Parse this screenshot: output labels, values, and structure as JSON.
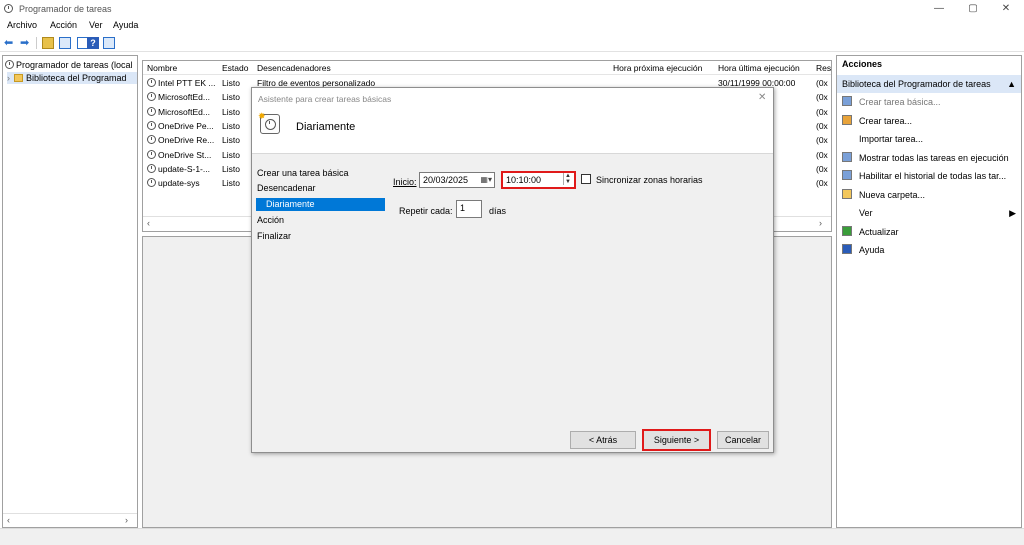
{
  "window": {
    "title": "Programador de tareas",
    "controls": {
      "minimize": "—",
      "maximize": "▢",
      "close": "✕"
    }
  },
  "menu": [
    "Archivo",
    "Acción",
    "Ver",
    "Ayuda"
  ],
  "tree": {
    "root": "Programador de tareas (local",
    "child": "Biblioteca del Programad"
  },
  "grid": {
    "columns": [
      "Nombre",
      "Estado",
      "Desencadenadores",
      "Hora próxima ejecución",
      "Hora última ejecución",
      "Res"
    ],
    "rows": [
      {
        "name": "Intel PTT EK ...",
        "status": "Listo",
        "trigger": "Filtro de eventos personalizado",
        "last": "30/11/1999 00:00:00",
        "res": "(0x"
      },
      {
        "name": "MicrosoftEd...",
        "status": "Listo",
        "last": ":35:44",
        "res": "(0x"
      },
      {
        "name": "MicrosoftEd...",
        "status": "Listo",
        "last": ":35:44",
        "res": "(0x"
      },
      {
        "name": "OneDrive Pe...",
        "status": "Listo",
        "last": ":43:42",
        "res": "(0x"
      },
      {
        "name": "OneDrive Re...",
        "status": "Listo",
        "last": ":59:16",
        "res": "(0x"
      },
      {
        "name": "OneDrive St...",
        "status": "Listo",
        "last": ":42:47",
        "res": "(0x"
      },
      {
        "name": "update-S-1-...",
        "status": "Listo",
        "last": ":35:44",
        "res": "(0x"
      },
      {
        "name": "update-sys",
        "status": "Listo",
        "last": ":51:01",
        "res": "(0x"
      }
    ]
  },
  "actions": {
    "header": "Acciones",
    "section": "Biblioteca del Programador de tareas",
    "items": [
      "Crear tarea básica...",
      "Crear tarea...",
      "Importar tarea...",
      "Mostrar todas las tareas en ejecución",
      "Habilitar el historial de todas las tar...",
      "Nueva carpeta...",
      "Ver",
      "Actualizar",
      "Ayuda"
    ]
  },
  "dialog": {
    "title": "Asistente para crear tareas básicas",
    "heading": "Diariamente",
    "steps": [
      "Crear una tarea básica",
      "Desencadenar",
      "Diariamente",
      "Acción",
      "Finalizar"
    ],
    "start_label": "Inicio:",
    "start_date": "20/03/2025",
    "start_time": "10:10:00",
    "sync_label": "Sincronizar zonas horarias",
    "repeat_label": "Repetir cada:",
    "repeat_value": "1",
    "repeat_unit": "días",
    "back_btn": "< Atrás",
    "next_btn": "Siguiente >",
    "cancel_btn": "Cancelar",
    "close": "✕"
  },
  "colors": {
    "selection": "#0078d7",
    "highlight": "#e01a1a"
  }
}
